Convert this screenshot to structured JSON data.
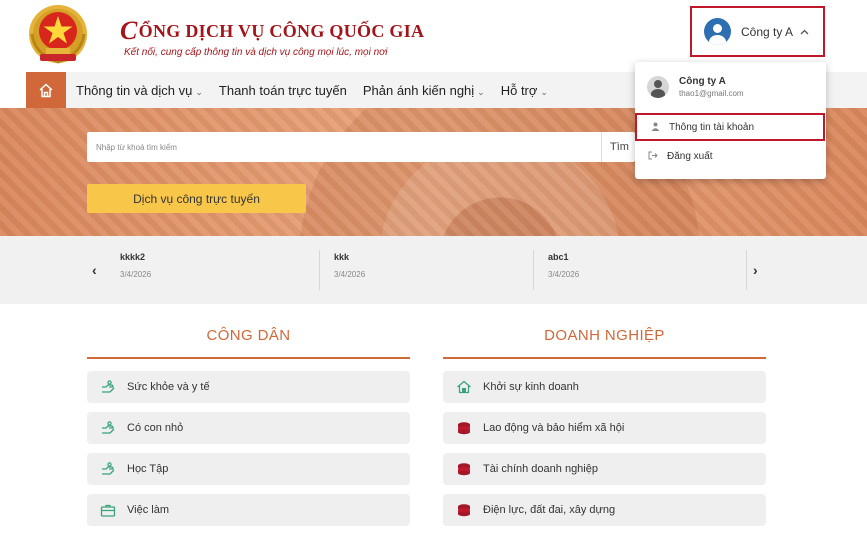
{
  "header": {
    "title_initial": "C",
    "title_rest": "ỔNG DỊCH VỤ CÔNG QUỐC GIA",
    "subtitle": "Kết nối, cung cấp thông tin và dịch vụ công mọi lúc, mọi nơi",
    "user_name": "Công ty A",
    "user_caret": "^"
  },
  "nav": {
    "items": [
      {
        "label": "Thông tin và dịch vụ",
        "has_dropdown": true
      },
      {
        "label": "Thanh toán trực tuyến",
        "has_dropdown": false
      },
      {
        "label": "Phản ánh kiến nghị",
        "has_dropdown": true
      },
      {
        "label": "Hỗ trợ",
        "has_dropdown": true
      }
    ],
    "chevron": "⌄"
  },
  "search": {
    "placeholder": "Nhập từ khoá tìm kiếm",
    "button_label": "Tìm"
  },
  "hero": {
    "service_button": "Dịch vụ công trực tuyến"
  },
  "news": {
    "prev": "‹",
    "next": "›",
    "items": [
      {
        "title": "kkkk2",
        "date": "3/4/2026"
      },
      {
        "title": "kkk",
        "date": "3/4/2026"
      },
      {
        "title": "abc1",
        "date": "3/4/2026"
      }
    ]
  },
  "citizen": {
    "title": "CÔNG DÂN",
    "items": [
      {
        "label": "Sức khỏe và y tế",
        "icon": "hand-icon"
      },
      {
        "label": "Có con nhỏ",
        "icon": "hand-icon"
      },
      {
        "label": "Học Tập",
        "icon": "hand-icon"
      },
      {
        "label": "Việc làm",
        "icon": "briefcase-icon"
      }
    ]
  },
  "business": {
    "title": "DOANH NGHIỆP",
    "items": [
      {
        "label": "Khởi sự kinh doanh",
        "icon": "house-icon"
      },
      {
        "label": "Lao động và bảo hiểm xã hội",
        "icon": "coins-icon"
      },
      {
        "label": "Tài chính doanh nghiệp",
        "icon": "coins-icon"
      },
      {
        "label": "Điện lực, đất đai, xây dựng",
        "icon": "coins-icon"
      }
    ]
  },
  "dropdown": {
    "name": "Công ty A",
    "email": "thao1@gmail.com",
    "account_info": "Thông tin tài khoản",
    "logout": "Đăng xuất"
  },
  "colors": {
    "brand_red": "#a4151b",
    "accent_orange": "#d0683a",
    "button_yellow": "#f8c74a",
    "icon_green": "#3aa37c",
    "highlight_red": "#c0182a"
  }
}
